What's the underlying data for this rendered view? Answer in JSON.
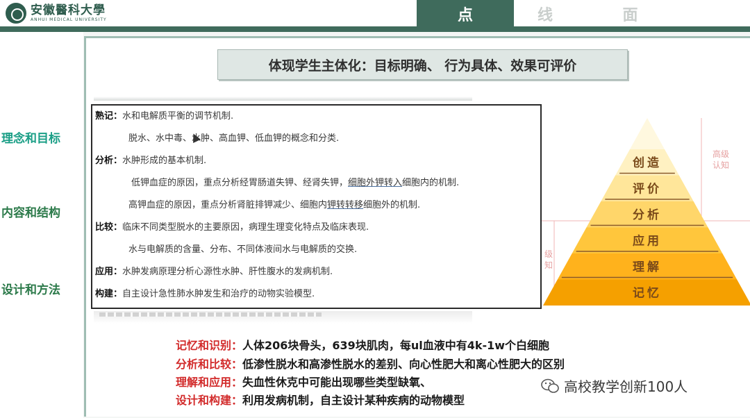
{
  "header": {
    "logo_cn": "安徽醫科大學",
    "logo_en": "ANHUI MEDICAL UNIVERSITY",
    "tabs": [
      {
        "label": "点",
        "active": true
      },
      {
        "label": "线",
        "active": false
      },
      {
        "label": "面",
        "active": false
      }
    ]
  },
  "nav": {
    "items": [
      {
        "label": "理念和目标",
        "color": "#1a9e86"
      },
      {
        "label": "内容和结构",
        "color": "#2c7a4a"
      },
      {
        "label": "设计和方法",
        "color": "#2c7a4a"
      }
    ]
  },
  "banner": {
    "title": "体现学生主体化：目标明确、 行为具体、效果可评价"
  },
  "objectives": [
    {
      "key": "熟记：",
      "text": "水和电解质平衡的调节机制."
    },
    {
      "key": "",
      "text": "脱水、水中毒、水肿、高血钾、低血钾的概念和分类."
    },
    {
      "key": "分析：",
      "text": "水肿形成的基本机制."
    },
    {
      "key": "",
      "text_a": "低钾血症的原因，重点分析经胃肠道失钾、经肾失钾，",
      "text_u": "细胞外钾转入",
      "text_b": "细胞内的机制."
    },
    {
      "key": "",
      "text_a": "高钾血症的原因，重点分析肾脏排钾减少、细胞内",
      "text_u": "钾转转移",
      "text_b": "细胞外的机制."
    },
    {
      "key": "比较：",
      "text": "临床不同类型脱水的主要原因，病理生理变化特点及临床表现."
    },
    {
      "key": "",
      "text": "水与电解质的含量、分布、不同体液间水与电解质的交换."
    },
    {
      "key": "应用：",
      "text": "水肿发病原理分析心源性水肿、肝性腹水的发病机制."
    },
    {
      "key": "构建：",
      "text": "自主设计急性肺水肿发生和治疗的动物实验模型."
    }
  ],
  "pyramid": {
    "levels": [
      "创造",
      "评价",
      "分析",
      "应用",
      "理解",
      "记忆"
    ],
    "high_label": [
      "高级",
      "认知"
    ],
    "low_label": [
      "级",
      "知"
    ],
    "colors": [
      "#fff1c2",
      "#ffe69a",
      "#ffd66a",
      "#ffc63c",
      "#ffb21c",
      "#f5a000"
    ]
  },
  "examples": [
    {
      "label": "记忆和识别：",
      "text": "人体206块骨头，639块肌肉，每ul血液中有4k-1w个白细胞"
    },
    {
      "label": "分析和比较：",
      "text": "低渗性脱水和高渗性脱水的差别、向心性肥大和离心性肥大的区别"
    },
    {
      "label": "理解和应用：",
      "text": "失血性休克中可能出现哪些类型缺氧、"
    },
    {
      "label": "设计和构建：",
      "text": "利用发病机制，自主设计某种疾病的动物模型"
    }
  ],
  "watermark": {
    "text": "高校教学创新100人"
  }
}
